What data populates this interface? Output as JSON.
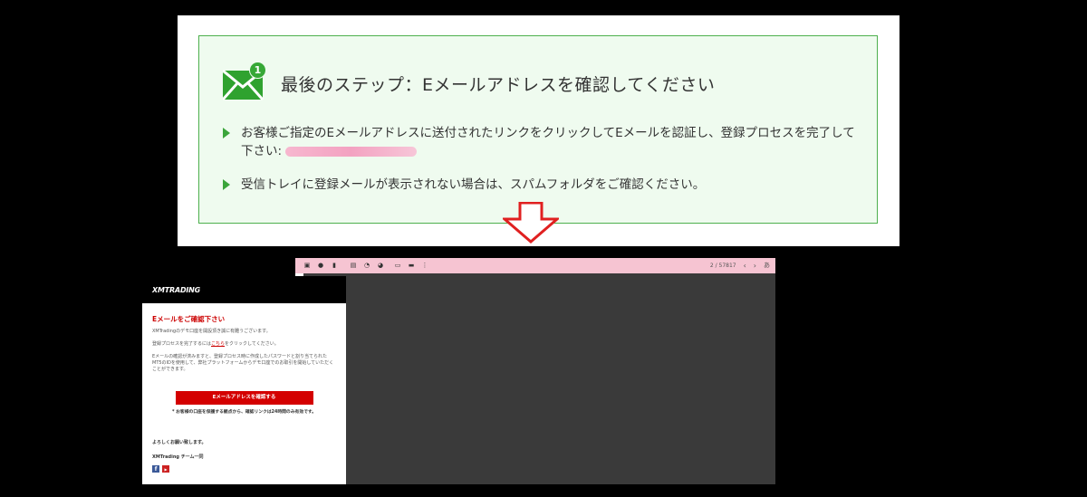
{
  "notice": {
    "badge_count": "1",
    "title": "最後のステップ：Eメールアドレスを確認してください",
    "item1_text": "お客様ご指定のEメールアドレスに送付されたリンクをクリックしてEメールを認証し、登録プロセスを完了して下さい:",
    "item2_text": "受信トレイに登録メールが表示されない場合は、スパムフォルダをご確認ください。"
  },
  "viewer": {
    "page_counter": "2 / 57817",
    "nav_prev": "‹",
    "nav_next": "›",
    "ime_label": "あ",
    "toolbar_icons": [
      "archive-icon",
      "spam-icon",
      "delete-icon",
      "mail-icon",
      "clock-icon",
      "check-icon",
      "move-icon",
      "label-icon"
    ]
  },
  "email": {
    "logo": "XMTRADING",
    "title": "Eメールをご確認下さい",
    "p1": "XMTradingのデモ口座を開設頂き誠に有難うございます。",
    "p2_before": "登録プロセスを完了するには",
    "p2_link": "こちら",
    "p2_after": "をクリックしてください。",
    "p3": "Eメールの確認が済みますと、登録プロセス時に作成したパスワードと割り当てられたMT5のIDを使用して、弊社プラットフォームからデモ口座でのお取引を開始していただくことができます。",
    "button_label": "Eメールアドレスを確認する",
    "note": "* お客様の口座を保護する観点から、確認リンクは24時間のみ有効です。",
    "sign_off": "よろしくお願い致します。",
    "team": "XMTrading チーム一同",
    "social_fb": "f",
    "social_yt": "▶"
  },
  "colors": {
    "notice_bg": "#effbef",
    "notice_border": "#4db04d",
    "accent_green": "#3ba53b",
    "arrow_red": "#e02020",
    "toolbar_pink": "#f6c4d2",
    "brand_red": "#d40000"
  }
}
